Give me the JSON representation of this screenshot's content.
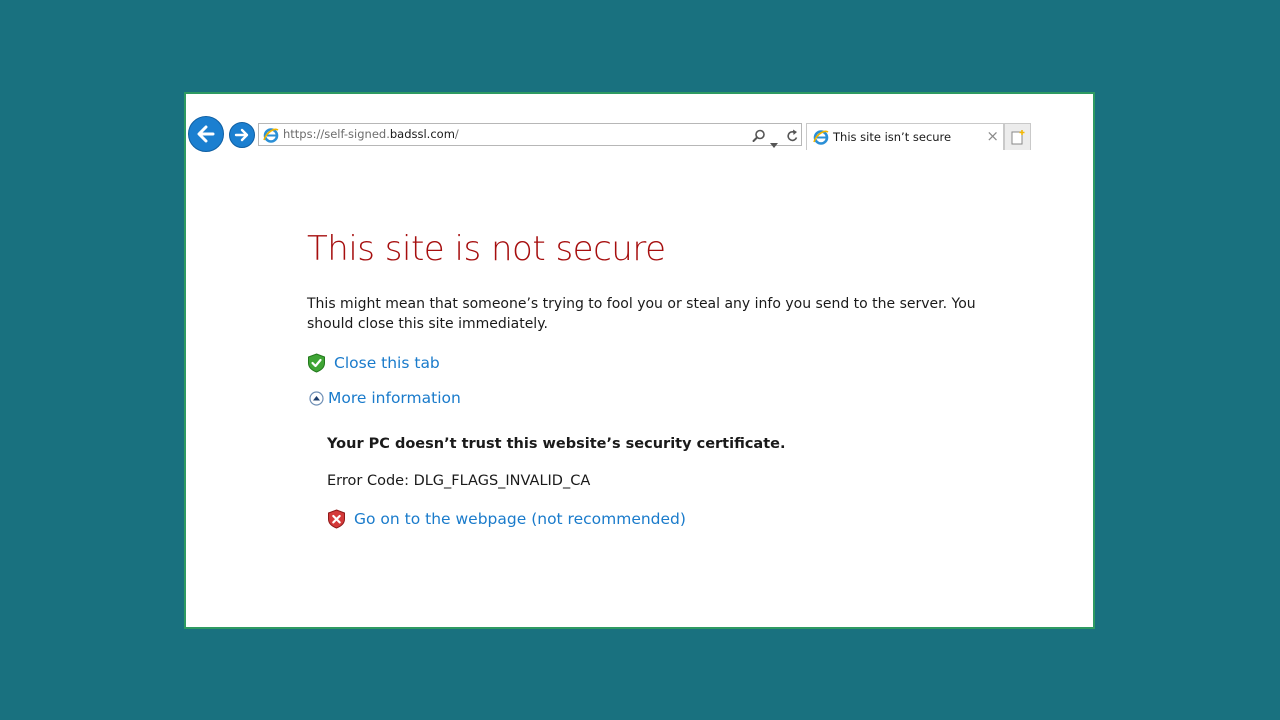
{
  "browser": {
    "address_bar": {
      "url_prefix": "https://self-signed.",
      "url_host": "badssl.com",
      "url_suffix": "/"
    },
    "tab": {
      "title": "This site isn’t secure",
      "close_glyph": "×"
    },
    "icons": {
      "back": "back-arrow-icon",
      "forward": "forward-arrow-icon",
      "favicon": "internet-explorer-icon",
      "search": "search-icon",
      "refresh": "refresh-icon",
      "new_tab": "new-tab-icon"
    }
  },
  "page": {
    "title": "This site is not secure",
    "description": "This might mean that someone’s trying to fool you or steal any info you send to the server. You should close this site immediately.",
    "close_tab_label": "Close this tab",
    "more_info_label": "More information",
    "detail_heading": "Your PC doesn’t trust this website’s security certificate.",
    "error_code": "Error Code: DLG_FLAGS_INVALID_CA",
    "proceed_label": "Go on to the webpage (not recommended)"
  },
  "colors": {
    "desktop_bg": "#19717f",
    "title_red": "#a60e0e",
    "link_blue": "#1a7bcb",
    "nav_blue": "#1b7fd0"
  }
}
